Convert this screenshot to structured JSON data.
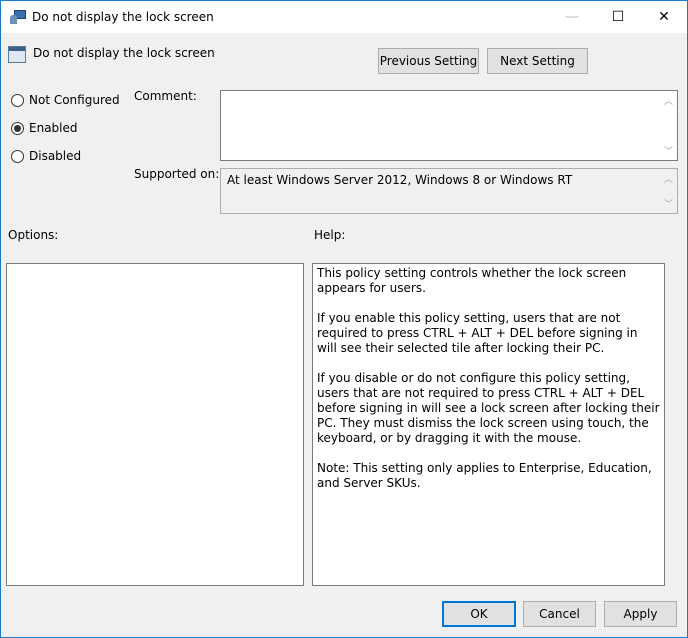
{
  "window": {
    "title": "Do not display the lock screen",
    "minimize": "—",
    "maximize": "☐",
    "close": "✕"
  },
  "header": {
    "policy_name": "Do not display the lock screen",
    "previous_label": "Previous Setting",
    "next_label": "Next Setting"
  },
  "state": {
    "options": [
      {
        "label": "Not Configured",
        "selected": false
      },
      {
        "label": "Enabled",
        "selected": true
      },
      {
        "label": "Disabled",
        "selected": false
      }
    ]
  },
  "comment": {
    "label": "Comment:",
    "value": ""
  },
  "supported": {
    "label": "Supported on:",
    "value": "At least Windows Server 2012, Windows 8 or Windows RT"
  },
  "options_label": "Options:",
  "help": {
    "label": "Help:",
    "paragraphs": [
      "This policy setting controls whether the lock screen appears for users.",
      "If you enable this policy setting, users that are not required to press CTRL + ALT + DEL before signing in will see their selected tile after locking their PC.",
      "If you disable or do not configure this policy setting, users that are not required to press CTRL + ALT + DEL before signing in will see a lock screen after locking their PC. They must dismiss the lock screen using touch, the keyboard, or by dragging it with the mouse.",
      "Note: This setting only applies to Enterprise, Education, and Server SKUs."
    ]
  },
  "footer": {
    "ok": "OK",
    "cancel": "Cancel",
    "apply": "Apply"
  }
}
